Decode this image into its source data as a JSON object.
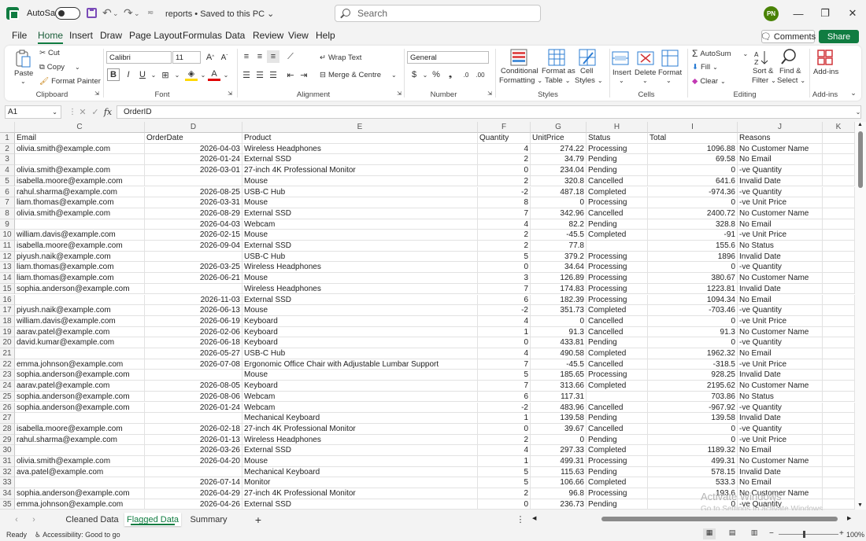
{
  "titlebar": {
    "autosave_label": "AutoSave",
    "doc_title": "reports • Saved to this PC ⌄",
    "search_placeholder": "Search",
    "user_initials": "PN"
  },
  "tabs": [
    "File",
    "Home",
    "Insert",
    "Draw",
    "Page Layout",
    "Formulas",
    "Data",
    "Review",
    "View",
    "Help"
  ],
  "active_tab": "Home",
  "comments_label": "Comments",
  "share_label": "Share",
  "ribbon": {
    "clipboard": {
      "paste": "Paste",
      "cut": "Cut",
      "copy": "Copy",
      "format_painter": "Format Painter",
      "label": "Clipboard"
    },
    "font": {
      "name": "Calibri",
      "size": "11",
      "label": "Font"
    },
    "alignment": {
      "wrap_text": "Wrap Text",
      "merge": "Merge & Centre",
      "label": "Alignment"
    },
    "number": {
      "format": "General",
      "label": "Number"
    },
    "styles": {
      "cond": [
        "Conditional",
        "Formatting"
      ],
      "table": [
        "Format as",
        "Table"
      ],
      "cell": [
        "Cell",
        "Styles"
      ],
      "label": "Styles"
    },
    "cells": {
      "insert": "Insert",
      "delete": "Delete",
      "format": "Format",
      "label": "Cells"
    },
    "editing": {
      "autosum": "AutoSum",
      "fill": "Fill",
      "clear": "Clear",
      "sort": [
        "Sort &",
        "Filter"
      ],
      "find": [
        "Find &",
        "Select"
      ],
      "label": "Editing"
    },
    "addins": {
      "addins": "Add-ins",
      "label": "Add-ins"
    }
  },
  "formula_bar": {
    "name_box": "A1",
    "value": "OrderID"
  },
  "columns": [
    "C",
    "D",
    "E",
    "F",
    "G",
    "H",
    "I",
    "J",
    "K"
  ],
  "headers": [
    "Email",
    "OrderDate",
    "Product",
    "Quantity",
    "UnitPrice",
    "Status",
    "Total",
    "Reasons"
  ],
  "rows": [
    [
      "olivia.smith@example.com",
      "2026-04-03",
      "Wireless Headphones",
      "4",
      "274.22",
      "Processing",
      "1096.88",
      "No Customer Name"
    ],
    [
      "",
      "2026-01-24",
      "External SSD",
      "2",
      "34.79",
      "Pending",
      "69.58",
      "No Email"
    ],
    [
      "olivia.smith@example.com",
      "2026-03-01",
      "27-inch 4K Professional Monitor",
      "0",
      "234.04",
      "Pending",
      "0",
      "-ve Quantity"
    ],
    [
      "isabella.moore@example.com",
      "",
      "Mouse",
      "2",
      "320.8",
      "Cancelled",
      "641.6",
      "Invalid Date"
    ],
    [
      "rahul.sharma@example.com",
      "2026-08-25",
      "USB-C Hub",
      "-2",
      "487.18",
      "Completed",
      "-974.36",
      "-ve Quantity"
    ],
    [
      "liam.thomas@example.com",
      "2026-03-31",
      "Mouse",
      "8",
      "0",
      "Processing",
      "0",
      "-ve Unit Price"
    ],
    [
      "olivia.smith@example.com",
      "2026-08-29",
      "External SSD",
      "7",
      "342.96",
      "Cancelled",
      "2400.72",
      "No Customer Name"
    ],
    [
      "",
      "2026-04-03",
      "Webcam",
      "4",
      "82.2",
      "Pending",
      "328.8",
      "No Email"
    ],
    [
      "william.davis@example.com",
      "2026-02-15",
      "Mouse",
      "2",
      "-45.5",
      "Completed",
      "-91",
      "-ve Unit Price"
    ],
    [
      "isabella.moore@example.com",
      "2026-09-04",
      "External SSD",
      "2",
      "77.8",
      "",
      "155.6",
      "No Status"
    ],
    [
      "piyush.naik@example.com",
      "",
      "USB-C Hub",
      "5",
      "379.2",
      "Processing",
      "1896",
      "Invalid Date"
    ],
    [
      "liam.thomas@example.com",
      "2026-03-25",
      "Wireless Headphones",
      "0",
      "34.64",
      "Processing",
      "0",
      "-ve Quantity"
    ],
    [
      "liam.thomas@example.com",
      "2026-06-21",
      "Mouse",
      "3",
      "126.89",
      "Processing",
      "380.67",
      "No Customer Name"
    ],
    [
      "sophia.anderson@example.com",
      "",
      "Wireless Headphones",
      "7",
      "174.83",
      "Processing",
      "1223.81",
      "Invalid Date"
    ],
    [
      "",
      "2026-11-03",
      "External SSD",
      "6",
      "182.39",
      "Processing",
      "1094.34",
      "No Email"
    ],
    [
      "piyush.naik@example.com",
      "2026-06-13",
      "Mouse",
      "-2",
      "351.73",
      "Completed",
      "-703.46",
      "-ve Quantity"
    ],
    [
      "william.davis@example.com",
      "2026-06-19",
      "Keyboard",
      "4",
      "0",
      "Cancelled",
      "0",
      "-ve Unit Price"
    ],
    [
      "aarav.patel@example.com",
      "2026-02-06",
      "Keyboard",
      "1",
      "91.3",
      "Cancelled",
      "91.3",
      "No Customer Name"
    ],
    [
      "david.kumar@example.com",
      "2026-06-18",
      "Keyboard",
      "0",
      "433.81",
      "Pending",
      "0",
      "-ve Quantity"
    ],
    [
      "",
      "2026-05-27",
      "USB-C Hub",
      "4",
      "490.58",
      "Completed",
      "1962.32",
      "No Email"
    ],
    [
      "emma.johnson@example.com",
      "2026-07-08",
      "Ergonomic Office Chair with Adjustable Lumbar Support",
      "7",
      "-45.5",
      "Cancelled",
      "-318.5",
      "-ve Unit Price"
    ],
    [
      "sophia.anderson@example.com",
      "",
      "Mouse",
      "5",
      "185.65",
      "Processing",
      "928.25",
      "Invalid Date"
    ],
    [
      "aarav.patel@example.com",
      "2026-08-05",
      "Keyboard",
      "7",
      "313.66",
      "Completed",
      "2195.62",
      "No Customer Name"
    ],
    [
      "sophia.anderson@example.com",
      "2026-08-06",
      "Webcam",
      "6",
      "117.31",
      "",
      "703.86",
      "No Status"
    ],
    [
      "sophia.anderson@example.com",
      "2026-01-24",
      "Webcam",
      "-2",
      "483.96",
      "Cancelled",
      "-967.92",
      "-ve Quantity"
    ],
    [
      "",
      "",
      "Mechanical Keyboard",
      "1",
      "139.58",
      "Pending",
      "139.58",
      "Invalid Date"
    ],
    [
      "isabella.moore@example.com",
      "2026-02-18",
      "27-inch 4K Professional Monitor",
      "0",
      "39.67",
      "Cancelled",
      "0",
      "-ve Quantity"
    ],
    [
      "rahul.sharma@example.com",
      "2026-01-13",
      "Wireless Headphones",
      "2",
      "0",
      "Pending",
      "0",
      "-ve Unit Price"
    ],
    [
      "",
      "2026-03-26",
      "External SSD",
      "4",
      "297.33",
      "Completed",
      "1189.32",
      "No Email"
    ],
    [
      "olivia.smith@example.com",
      "2026-04-20",
      "Mouse",
      "1",
      "499.31",
      "Processing",
      "499.31",
      "No Customer Name"
    ],
    [
      "ava.patel@example.com",
      "",
      "Mechanical Keyboard",
      "5",
      "115.63",
      "Pending",
      "578.15",
      "Invalid Date"
    ],
    [
      "",
      "2026-07-14",
      "Monitor",
      "5",
      "106.66",
      "Completed",
      "533.3",
      "No Email"
    ],
    [
      "sophia.anderson@example.com",
      "2026-04-29",
      "27-inch 4K Professional Monitor",
      "2",
      "96.8",
      "Processing",
      "193.6",
      "No Customer Name"
    ],
    [
      "emma.johnson@example.com",
      "2026-04-26",
      "External SSD",
      "0",
      "236.73",
      "Pending",
      "0",
      "-ve Quantity"
    ]
  ],
  "sheets": [
    "Cleaned Data",
    "Flagged Data",
    "Summary"
  ],
  "active_sheet": "Flagged Data",
  "status": {
    "ready": "Ready",
    "accessibility": "Accessibility: Good to go",
    "zoom": "100%"
  },
  "watermark": {
    "line1": "Activate Windows",
    "line2": "Go to Settings to activate Windows."
  }
}
